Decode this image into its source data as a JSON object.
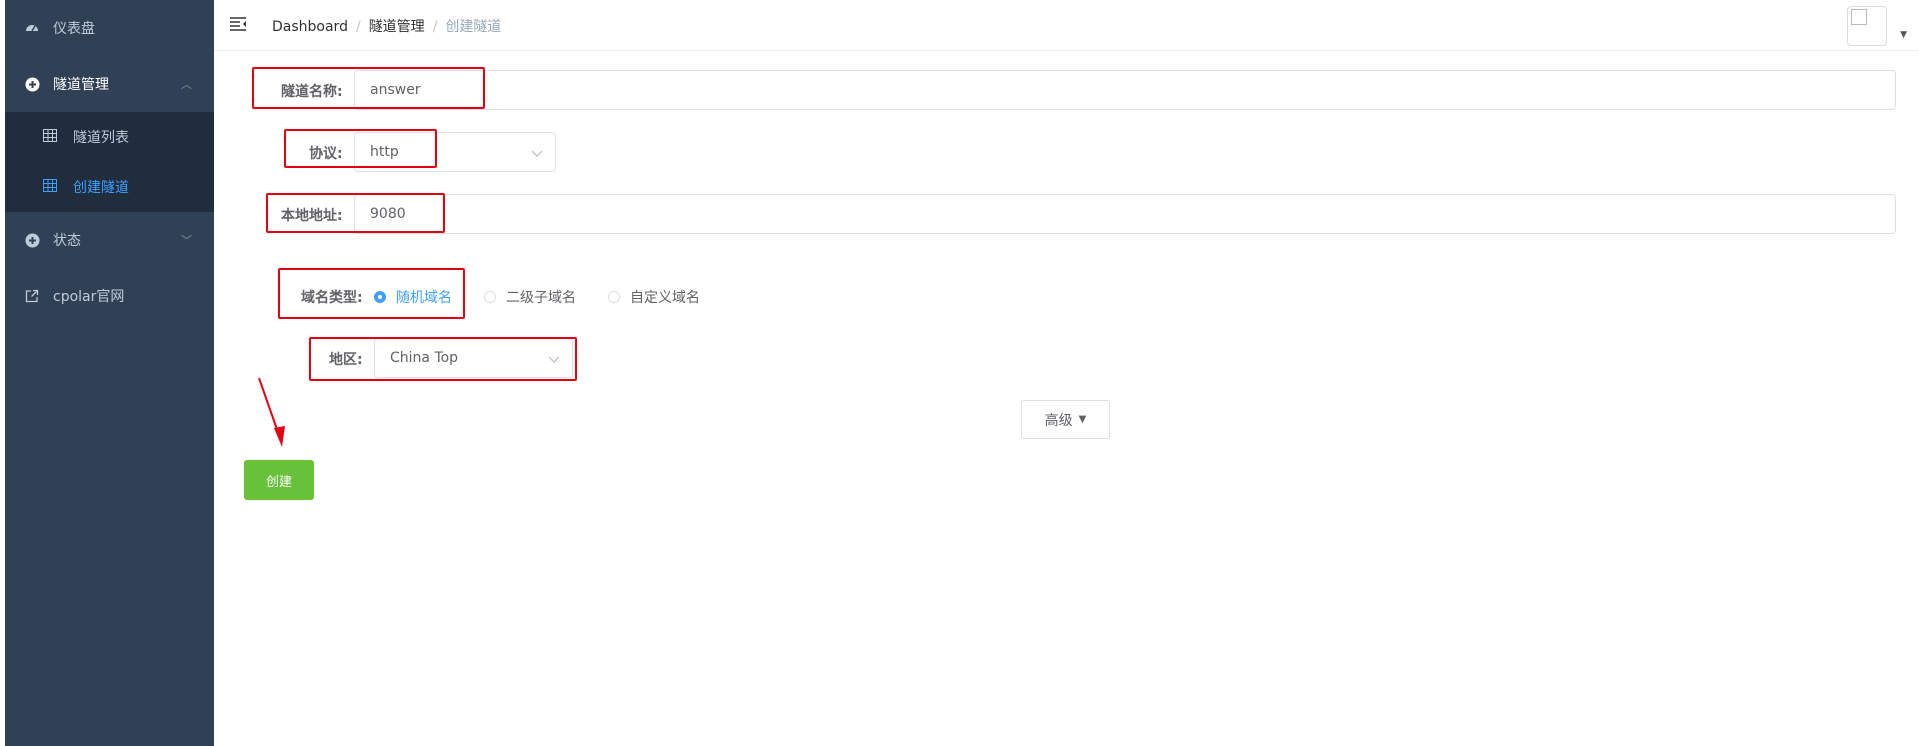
{
  "sidebar": {
    "items": [
      {
        "label": "仪表盘",
        "icon": "dashboard-icon"
      },
      {
        "label": "隧道管理",
        "icon": "plus-circle-icon",
        "expanded": true
      },
      {
        "label": "状态",
        "icon": "plus-circle-icon",
        "expanded": false
      },
      {
        "label": "cpolar官网",
        "icon": "external-link-icon"
      }
    ],
    "submenu": [
      {
        "label": "隧道列表",
        "icon": "table-icon"
      },
      {
        "label": "创建隧道",
        "icon": "table-icon",
        "active": true
      }
    ]
  },
  "header": {
    "breadcrumb": [
      "Dashboard",
      "隧道管理",
      "创建隧道"
    ]
  },
  "form": {
    "tunnel_name": {
      "label": "隧道名称:",
      "value": "answer"
    },
    "protocol": {
      "label": "协议:",
      "value": "http"
    },
    "local_address": {
      "label": "本地地址:",
      "value": "9080"
    },
    "domain_type": {
      "label": "域名类型:",
      "options": [
        "随机域名",
        "二级子域名",
        "自定义域名"
      ],
      "selected": "随机域名"
    },
    "region": {
      "label": "地区:",
      "value": "China Top"
    },
    "advanced_label": "高级",
    "create_label": "创建"
  },
  "colors": {
    "sidebar_bg": "#304156",
    "submenu_bg": "#1f2d3d",
    "active": "#409eff",
    "create_button": "#67c23a",
    "highlight_box": "#e60012"
  }
}
